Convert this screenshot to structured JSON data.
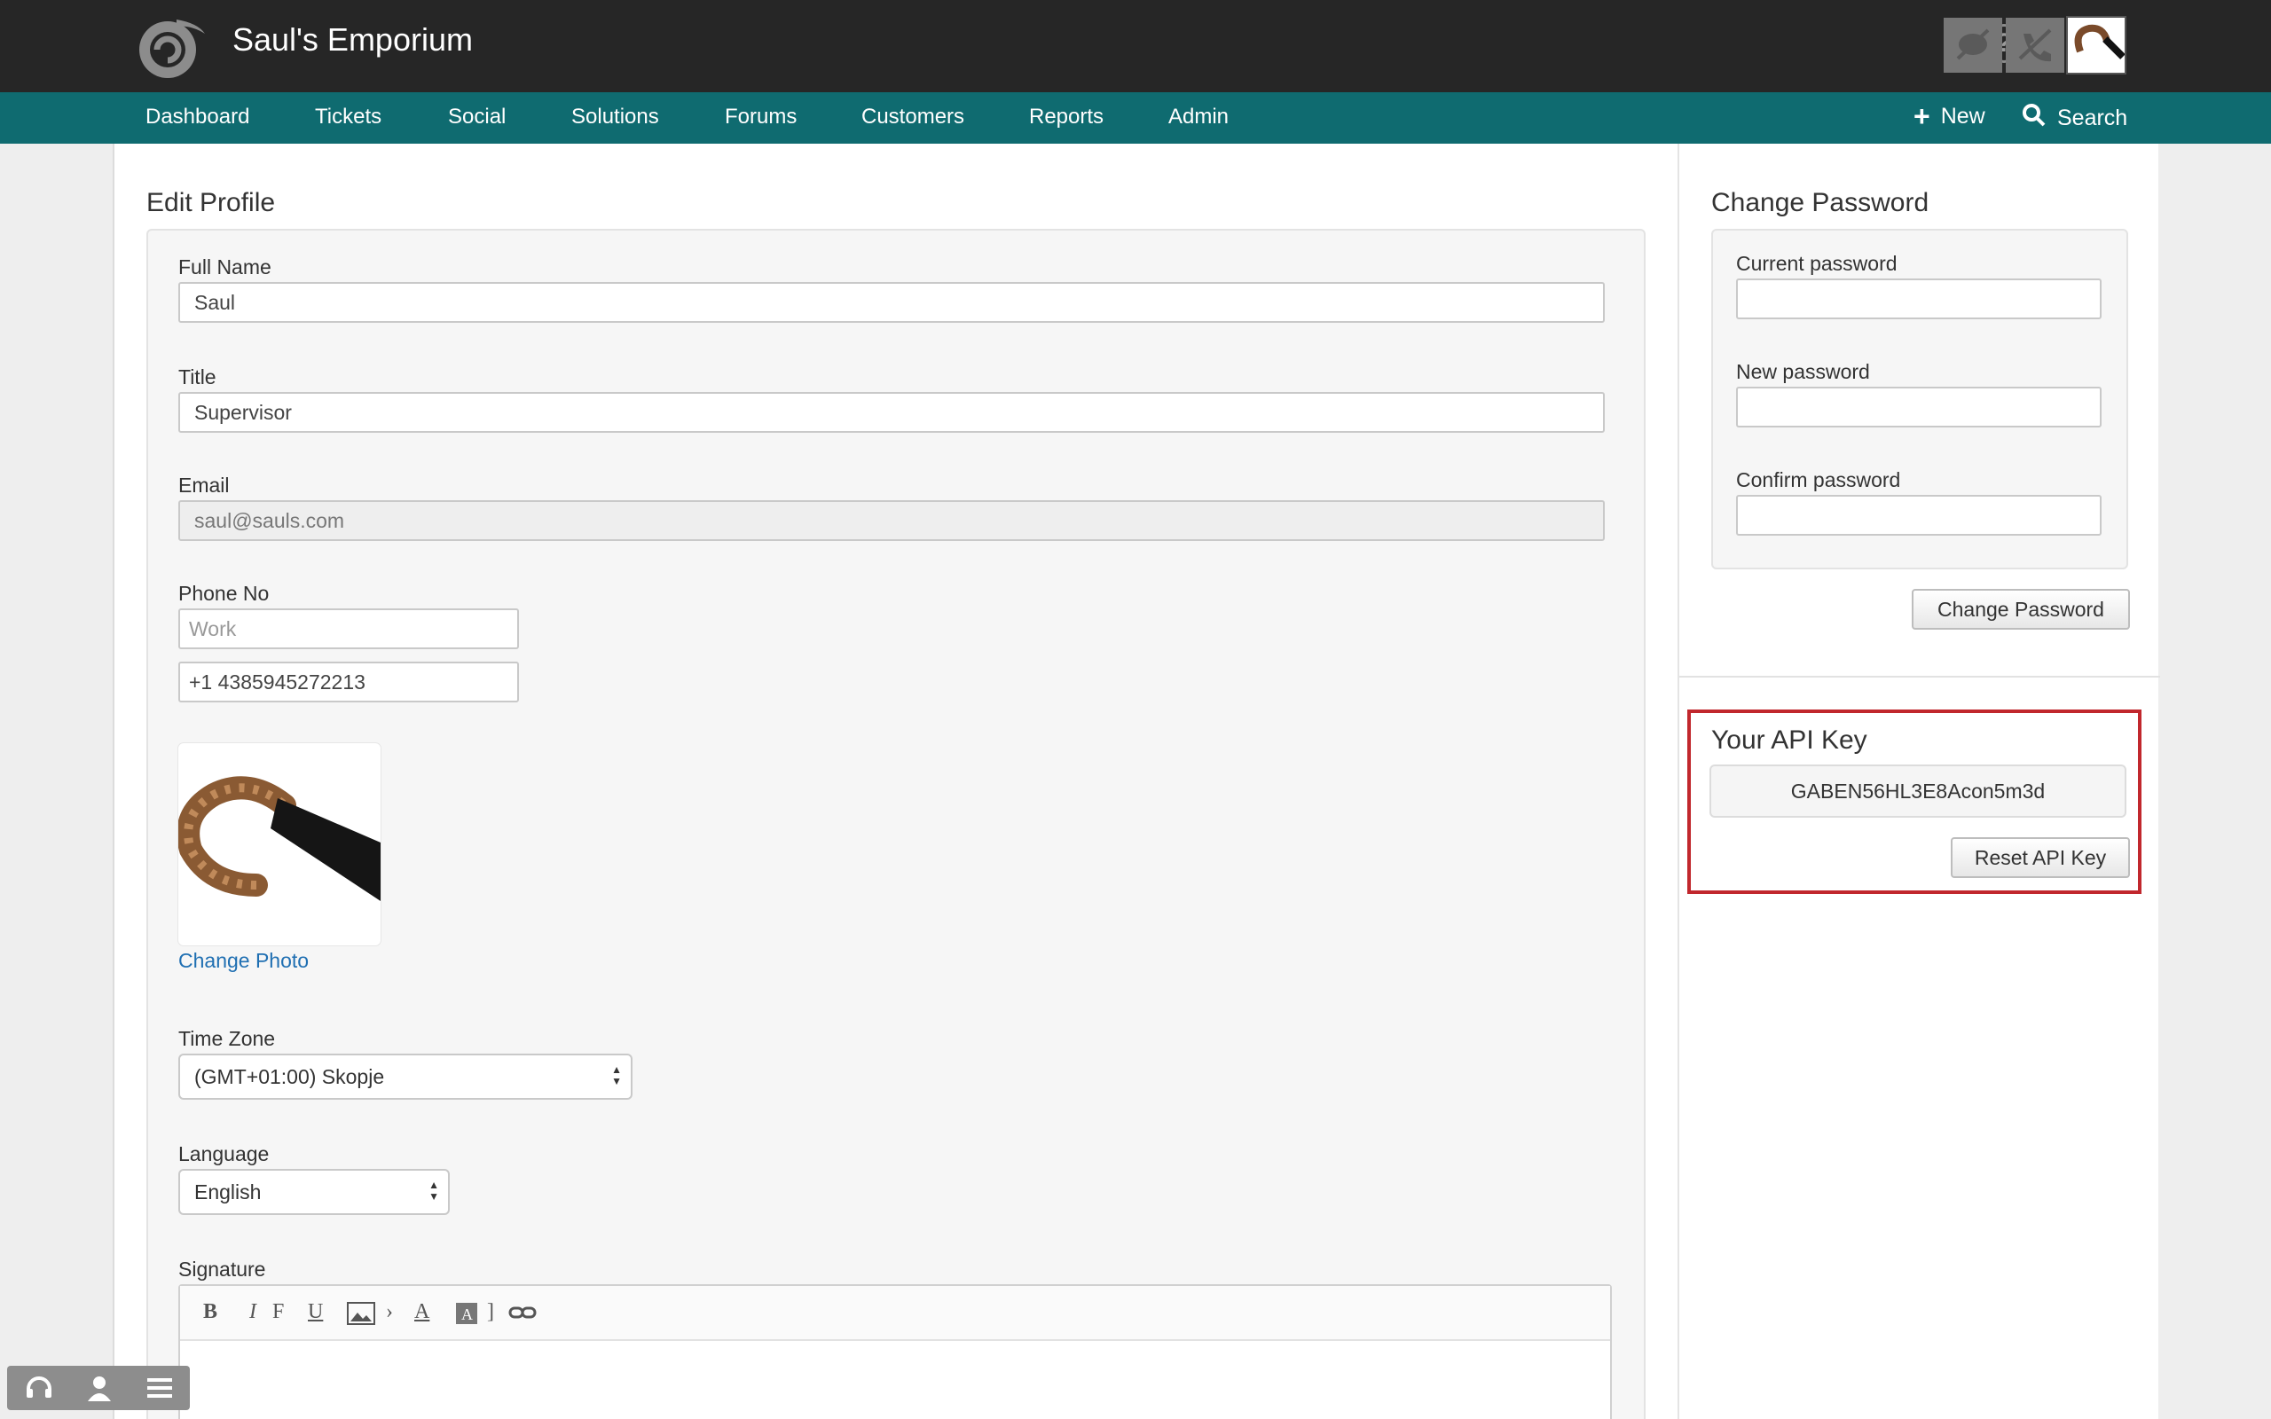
{
  "header": {
    "brand": "Saul's Emporium",
    "help_icon": "?"
  },
  "nav": {
    "items": [
      "Dashboard",
      "Tickets",
      "Social",
      "Solutions",
      "Forums",
      "Customers",
      "Reports",
      "Admin"
    ],
    "new_label": "New",
    "search_label": "Search"
  },
  "profile": {
    "heading": "Edit Profile",
    "full_name_label": "Full Name",
    "full_name_value": "Saul",
    "title_label": "Title",
    "title_value": "Supervisor",
    "email_label": "Email",
    "email_value": "saul@sauls.com",
    "phone_label": "Phone No",
    "phone_type_placeholder": "Work",
    "phone_value": "+1 4385945272213",
    "change_photo": "Change Photo",
    "timezone_label": "Time Zone",
    "timezone_value": "(GMT+01:00) Skopje",
    "language_label": "Language",
    "language_value": "English",
    "signature_label": "Signature"
  },
  "password": {
    "heading": "Change Password",
    "current_label": "Current password",
    "new_label": "New password",
    "confirm_label": "Confirm password",
    "button": "Change Password"
  },
  "api": {
    "heading": "Your API Key",
    "key": "GABEN56HL3E8Acon5m3d",
    "reset_button": "Reset API Key",
    "highlight_color": "#c1272d"
  },
  "colors": {
    "topbar": "#262626",
    "navbar": "#0f6b70",
    "link": "#1f6fb2"
  }
}
